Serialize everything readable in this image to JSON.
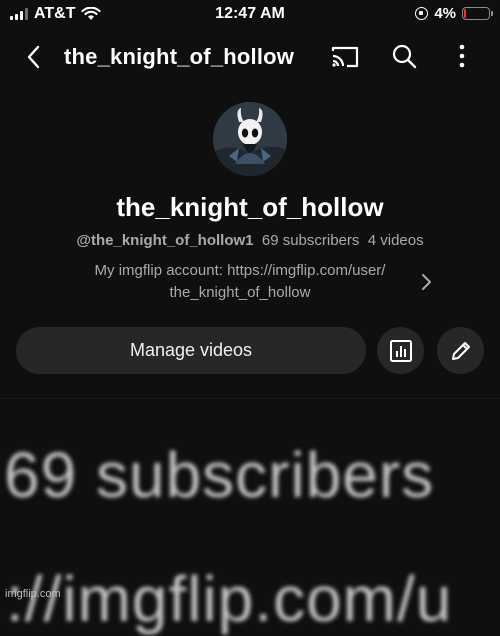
{
  "status_bar": {
    "carrier": "AT&T",
    "time": "12:47 AM",
    "battery": "4%"
  },
  "header": {
    "title": "the_knight_of_hollow",
    "icons": [
      "back-icon",
      "cast-icon",
      "search-icon",
      "more-icon"
    ]
  },
  "channel": {
    "name": "the_knight_of_hollow",
    "handle": "@the_knight_of_hollow1",
    "subscribers": "69 subscribers",
    "videos": "4 videos",
    "description_line1": "My imgflip account: https://imgflip.com/user/",
    "description_line2": "the_knight_of_hollow"
  },
  "actions": {
    "manage_label": "Manage videos",
    "analytics_icon": "analytics-icon",
    "edit_icon": "pencil-icon"
  },
  "zoomed": {
    "line1": "69 subscribers",
    "line2": "://imgflip.com/u"
  },
  "watermark": "imgflip.com",
  "colors": {
    "background": "#0f0f0f",
    "button": "#272727",
    "secondary_text": "#aaaaaa",
    "battery_low": "#e5372b"
  }
}
